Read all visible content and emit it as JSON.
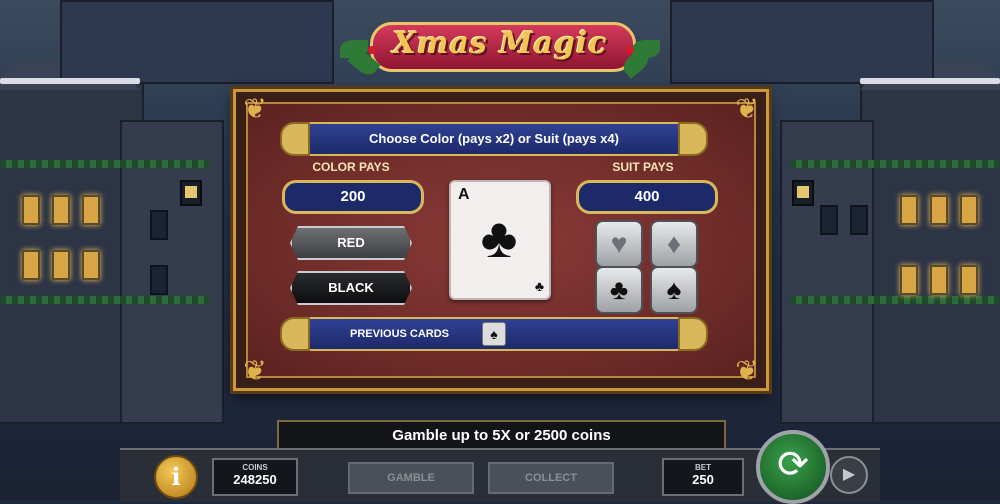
{
  "game": {
    "logo_text": "Xmas Magic"
  },
  "gamble": {
    "header": "Choose Color (pays x2) or Suit (pays x4)",
    "color_pays_label": "COLOR PAYS",
    "color_pays_value": "200",
    "suit_pays_label": "SUIT PAYS",
    "suit_pays_value": "400",
    "red_label": "RED",
    "black_label": "BLACK",
    "card": {
      "rank": "A",
      "suit": "clubs"
    },
    "previous_cards_label": "PREVIOUS CARDS",
    "suits": [
      "hearts",
      "diamonds",
      "clubs",
      "spades"
    ]
  },
  "footer": {
    "message": "Gamble up to 5X or 2500 coins",
    "coins_label": "COINS",
    "coins_value": "248250",
    "gamble_label": "GAMBLE",
    "collect_label": "COLLECT",
    "bet_label": "BET",
    "bet_value": "250"
  }
}
